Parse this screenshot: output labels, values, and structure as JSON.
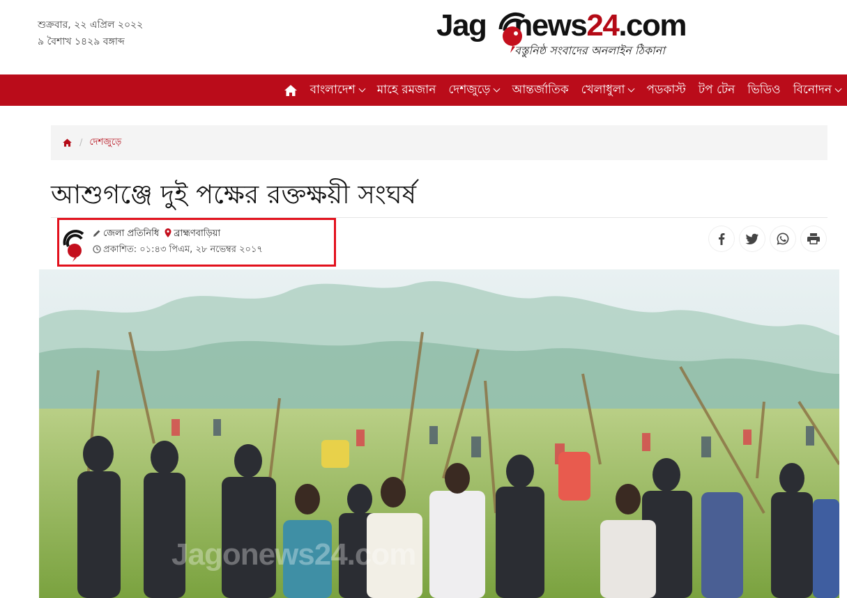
{
  "header": {
    "date_bn": "শুক্রবার, ২২ এপ্রিল ২০২২",
    "date_bangla": "৯ বৈশাখ ১৪২৯ বঙ্গাব্দ",
    "logo": {
      "text_part1": "Jag",
      "text_part2": "news",
      "text_part3": "24",
      "text_part4": ".com",
      "tagline": "বস্তুনিষ্ঠ সংবাদের অনলাইন ঠিকানা"
    }
  },
  "nav": {
    "items": [
      {
        "label": "বাংলাদেশ",
        "has_dropdown": true
      },
      {
        "label": "মাহে রমজান",
        "has_dropdown": false
      },
      {
        "label": "দেশজুড়ে",
        "has_dropdown": true
      },
      {
        "label": "আন্তর্জাতিক",
        "has_dropdown": false
      },
      {
        "label": "খেলাধুলা",
        "has_dropdown": true
      },
      {
        "label": "পডকাস্ট",
        "has_dropdown": false
      },
      {
        "label": "টপ টেন",
        "has_dropdown": false
      },
      {
        "label": "ভিডিও",
        "has_dropdown": false
      },
      {
        "label": "বিনোদন",
        "has_dropdown": true
      }
    ]
  },
  "breadcrumb": {
    "separator": "/",
    "current": "দেশজুড়ে"
  },
  "article": {
    "headline": "আশুগঞ্জে দুই পক্ষের রক্তক্ষয়ী সংঘর্ষ",
    "author": "জেলা প্রতিনিধি",
    "location": "ব্রাহ্মণবাড়িয়া",
    "published": "প্রকাশিত: ০১:৪৩ পিএম, ২৮ নভেম্বর ২০১৭",
    "image_watermark": "Jagonews24.com"
  },
  "colors": {
    "brand_red": "#ba0c1a",
    "highlight_border": "#e2101c"
  }
}
